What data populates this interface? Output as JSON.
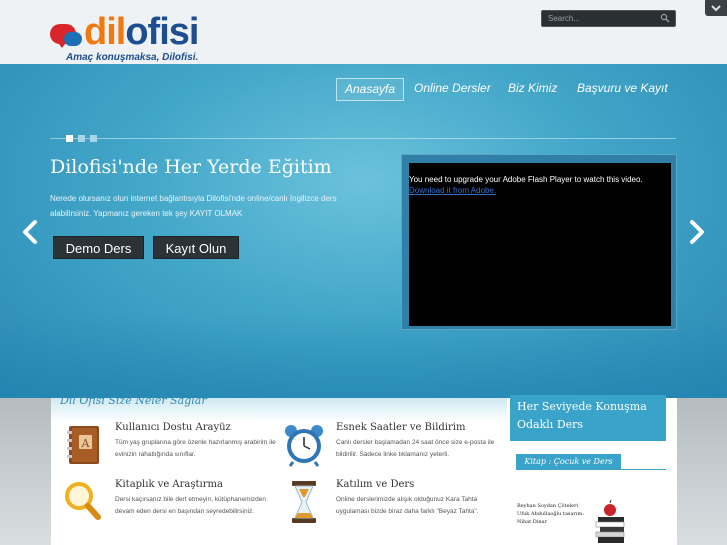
{
  "header": {
    "logo": {
      "word_part1": "dil",
      "word_part2": "ofisi",
      "tagline": "Amaç konuşmaksa, Dilofisi."
    },
    "search": {
      "placeholder": "Search..."
    }
  },
  "nav": {
    "items": [
      {
        "label": "Anasayfa",
        "active": true
      },
      {
        "label": "Online Dersler",
        "active": false
      },
      {
        "label": "Biz Kimiz",
        "active": false
      },
      {
        "label": "Başvuru ve Kayıt",
        "active": false
      }
    ]
  },
  "hero": {
    "slider": {
      "slide_count": 3,
      "active_index": 0
    },
    "title": "Dilofisi'nde Her Yerde Eğitim",
    "text": "Nerede olursanız olun internet bağlantısıyla Dilofisi'nde online/canlı İngilizce ders alabilirsiniz. Yapmanız gereken tek şey KAYIT OLMAK",
    "demo_button": "Demo Ders",
    "register_button": "Kayıt Olun",
    "video": {
      "message": "You need to upgrade your Adobe Flash Player to watch this video.",
      "link": "Download it from Adobe."
    }
  },
  "features": {
    "title": "Dil Ofisi Size Neler Sağlar",
    "items": [
      {
        "title": "Kullanıcı Dostu Arayüz",
        "text": "Tüm yaş gruplarına göre özenle hazırlanmış arabirim ile evinizin rahatlığında sınıflar.",
        "icon": "address-book-icon"
      },
      {
        "title": "Esnek Saatler ve Bildirim",
        "text": "Canlı dersler başlamadan 24 saat önce size e-posta ile bildirilir. Sadece linke tıklamanız yeterli.",
        "icon": "alarm-clock-icon"
      },
      {
        "title": "Kitaplık ve Araştırma",
        "text": "Dersi kaçırsanız bile dert etmeyin, kütüphanemizden devam eden dersi en başından seyredebilirsiniz.",
        "icon": "magnifier-icon"
      },
      {
        "title": "Katılım ve Ders",
        "text": "Online derslerimizde alışık olduğunuz Kara Tahta uygulaması bizde biraz daha farklı \"Beyaz Tahta\".",
        "icon": "hourglass-icon"
      }
    ]
  },
  "sidebar": {
    "box_title": "Her Seviyede Konuşma Odaklı Ders",
    "label": "Kitap : Çocuk ve Ders",
    "book_text": "Beyhan Soydan Çöteleri Ufuk Abdullaoğlu tasarım: Nihat Dinar"
  },
  "colors": {
    "accent_blue": "#3aa3c9",
    "logo_orange": "#f07a10",
    "logo_navy": "#1d4e8f",
    "button_dark": "#2b3337"
  }
}
